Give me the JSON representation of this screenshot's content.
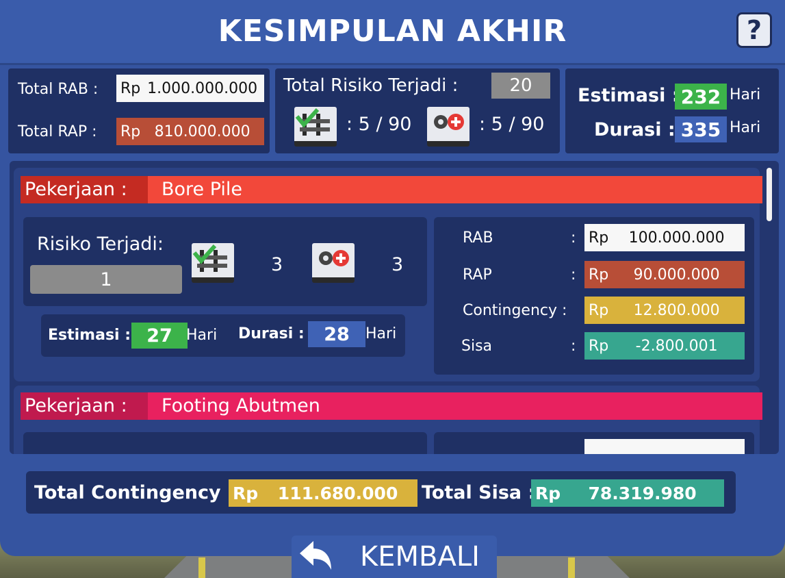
{
  "title": "KESIMPULAN AKHIR",
  "help_label": "?",
  "summary": {
    "total_rab_label": "Total RAB :",
    "total_rab_currency": "Rp",
    "total_rab_value": "1.000.000.000",
    "total_rap_label": "Total RAP :",
    "total_rap_currency": "Rp",
    "total_rap_value": "810.000.000",
    "risk_label": "Total Risiko Terjadi :",
    "risk_value": "20",
    "mitigated_count": ": 5 / 90",
    "added_count": ": 5 / 90",
    "estimasi_label": "Estimasi :",
    "estimasi_value": "232",
    "estimasi_unit": "Hari",
    "durasi_label": "Durasi :",
    "durasi_value": "335",
    "durasi_unit": "Hari"
  },
  "works": [
    {
      "label": "Pekerjaan :",
      "name": "Bore Pile",
      "color": "#f2483a",
      "label_color": "#c42b22",
      "risk_label": "Risiko Terjadi:",
      "risk_value": "1",
      "mitigated": "3",
      "added": "3",
      "estimasi_label": "Estimasi :",
      "estimasi_value": "27",
      "estimasi_unit": "Hari",
      "durasi_label": "Durasi :",
      "durasi_value": "28",
      "durasi_unit": "Hari",
      "rab_label": "RAB",
      "rab_value": "100.000.000",
      "rap_label": "RAP",
      "rap_value": "90.000.000",
      "contingency_label": "Contingency :",
      "contingency_value": "12.800.000",
      "sisa_label": "Sisa",
      "sisa_value": "-2.800.001",
      "colon": ":",
      "currency": "Rp"
    },
    {
      "label": "Pekerjaan :",
      "name": "Footing Abutmen",
      "color": "#e8215f",
      "label_color": "#c01a4e"
    }
  ],
  "totals": {
    "contingency_label": "Total Contingency :",
    "contingency_currency": "Rp",
    "contingency_value": "111.680.000",
    "sisa_label": "Total Sisa :",
    "sisa_currency": "Rp",
    "sisa_value": "78.319.980"
  },
  "back_label": "KEMBALI",
  "icons": {
    "mitigated": "checklist-structure-icon",
    "added": "gear-plus-icon",
    "back": "back-arrow-icon"
  }
}
